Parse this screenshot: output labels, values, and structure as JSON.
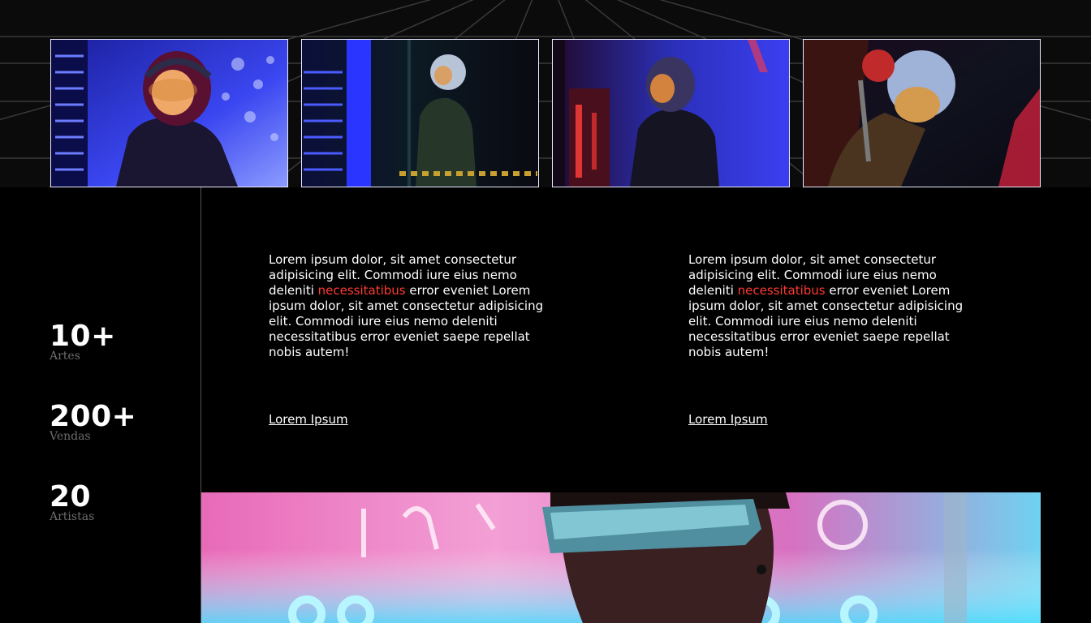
{
  "gallery": [
    {
      "alt": "astronaut-photo-1"
    },
    {
      "alt": "astronaut-photo-2"
    },
    {
      "alt": "astronaut-photo-3"
    },
    {
      "alt": "astronaut-photo-4"
    }
  ],
  "stats": [
    {
      "value": "10+",
      "label": "Artes"
    },
    {
      "value": "200+",
      "label": "Vendas"
    },
    {
      "value": "20",
      "label": "Artistas"
    }
  ],
  "columns": [
    {
      "text_before": "Lorem ipsum dolor, sit amet consectetur adipisicing elit. Commodi iure eius nemo deleniti ",
      "highlight": "necessitatibus",
      "text_after": " error eveniet Lorem ipsum dolor, sit amet consectetur adipisicing elit. Commodi iure eius nemo deleniti necessitatibus error eveniet saepe repellat nobis autem!",
      "link": "Lorem Ipsum"
    },
    {
      "text_before": "Lorem ipsum dolor, sit amet consectetur adipisicing elit. Commodi iure eius nemo deleniti ",
      "highlight": "necessitatibus",
      "text_after": " error eveniet Lorem ipsum dolor, sit amet consectetur adipisicing elit. Commodi iure eius nemo deleniti necessitatibus error eveniet saepe repellat nobis autem!",
      "link": "Lorem Ipsum"
    }
  ],
  "colors": {
    "accent": "#ff3b30",
    "background": "#000000",
    "muted_label": "#6e6e6e"
  }
}
